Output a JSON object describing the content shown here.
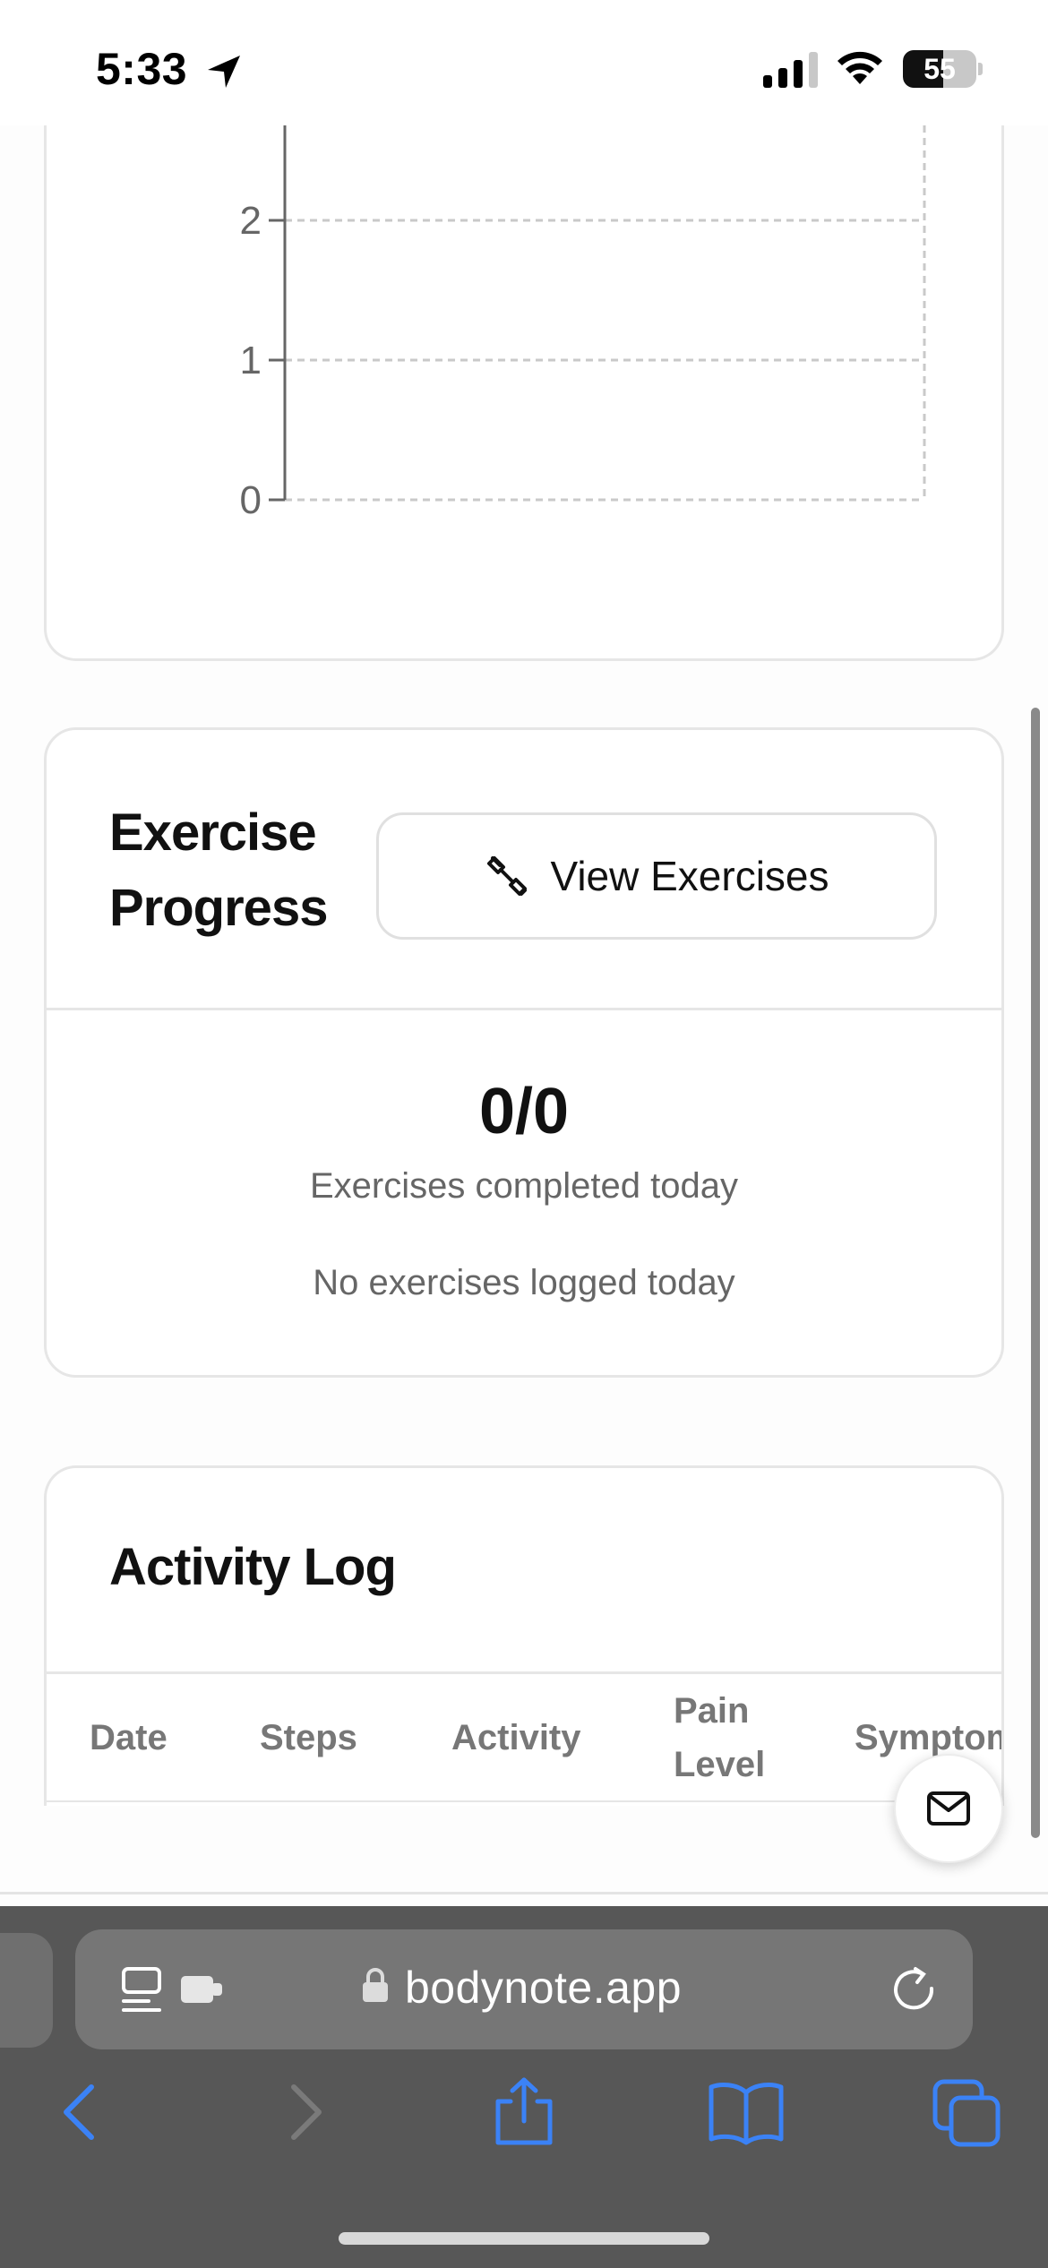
{
  "status_bar": {
    "time": "5:33",
    "battery_level": "55",
    "battery_fraction": 0.55
  },
  "chart_data": {
    "type": "line",
    "y_ticks": [
      "0",
      "1",
      "2"
    ],
    "ylim": [
      0,
      2.7
    ],
    "grid": true,
    "series": []
  },
  "exercise": {
    "title": "Exercise Progress",
    "view_button": "View Exercises",
    "count": "0/0",
    "subtitle": "Exercises completed today",
    "empty_text": "No exercises logged today"
  },
  "activity": {
    "title": "Activity Log",
    "columns": {
      "date": "Date",
      "steps": "Steps",
      "activity": "Activity",
      "pain_level": "Pain Level",
      "symptoms": "Symptoms"
    }
  },
  "safari": {
    "url": "bodynote.app"
  },
  "colors": {
    "accent": "#3b82f6",
    "safari_chrome": "#575757",
    "card_border": "#e6e6e6",
    "muted_text": "#666666"
  },
  "icons": {
    "location": "location-arrow-icon",
    "signal": "cellular-signal-icon",
    "wifi": "wifi-icon",
    "exercise": "dumbbell-icon",
    "mail": "mail-icon",
    "reader": "reader-mode-icon",
    "lock": "lock-icon",
    "reload": "reload-icon",
    "back": "back-chevron-icon",
    "forward": "forward-chevron-icon",
    "share": "share-icon",
    "bookmarks": "bookmarks-icon",
    "tabs": "tabs-icon"
  }
}
